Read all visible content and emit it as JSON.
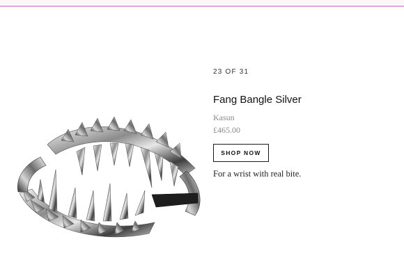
{
  "accent_strip_color": "#e3a7dc",
  "product": {
    "counter": "23 OF 31",
    "title": "Fang Bangle Silver",
    "designer": "Kasun",
    "price": "£465.00",
    "cta_label": "SHOP NOW",
    "tagline": "For a wrist with real bite.",
    "image_icon": "fang-bangle-image"
  }
}
